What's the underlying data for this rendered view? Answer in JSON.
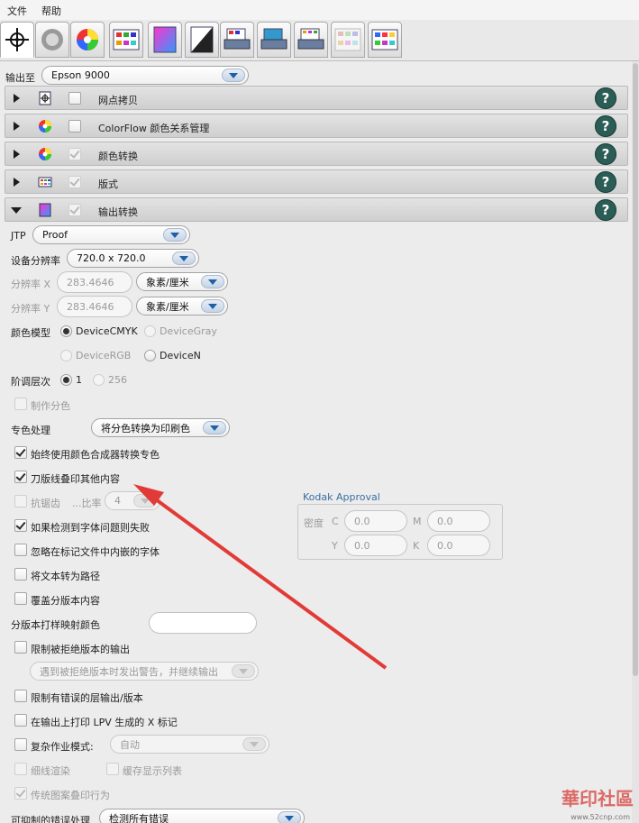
{
  "menu": {
    "file": "文件",
    "help": "帮助"
  },
  "output": {
    "label": "输出至",
    "device": "Epson 9000"
  },
  "sections": [
    {
      "title": "网点拷贝",
      "checked": false
    },
    {
      "title": "ColorFlow 颜色关系管理",
      "checked": false
    },
    {
      "title": "颜色转换",
      "checked": true
    },
    {
      "title": "版式",
      "checked": true
    },
    {
      "title": "输出转换",
      "checked": true
    }
  ],
  "help_glyph": "?",
  "jtp": {
    "label": "JTP",
    "value": "Proof"
  },
  "device_res": {
    "label": "设备分辨率",
    "value": "720.0 x 720.0"
  },
  "res_x": {
    "label": "分辨率 X",
    "value": "283.4646",
    "unit": "象素/厘米"
  },
  "res_y": {
    "label": "分辨率 Y",
    "value": "283.4646",
    "unit": "象素/厘米"
  },
  "color_model": {
    "label": "颜色模型",
    "options": [
      "DeviceCMYK",
      "DeviceGray",
      "DeviceRGB",
      "DeviceN"
    ],
    "selected": "DeviceCMYK"
  },
  "levels": {
    "label": "阶调层次",
    "options": [
      "1",
      "256"
    ],
    "selected": "1"
  },
  "make_separations": "制作分色",
  "spot": {
    "label": "专色处理",
    "value": "将分色转换为印刷色"
  },
  "checks": {
    "always_composite": "始终使用颜色合成器转换专色",
    "knife_overprint": "刀版线叠印其他内容",
    "antialias": "抗锯齿",
    "ratio_label": "...比率",
    "ratio_value": "4",
    "fail_font": "如果检测到字体问题则失败",
    "ignore_embedded": "忽略在标记文件中内嵌的字体",
    "text_to_path": "将文本转为路径",
    "overlay_version": "覆盖分版本内容",
    "limit_rejected": "限制被拒绝版本的输出",
    "limit_error_layers": "限制有错误的层输出/版本",
    "print_lpv": "在输出上打印 LPV 生成的 X 标记",
    "complex_mode": "复杂作业模式:",
    "thin_render": "细线渲染",
    "cache_list": "缓存显示列表",
    "legacy_overprint": "传统图案叠印行为"
  },
  "version_color": {
    "label": "分版本打样映射颜色",
    "value": ""
  },
  "rejected_action": "遇到被拒绝版本时发出警告，并继续输出",
  "complex_value": "自动",
  "controllable_errors": {
    "label": "可抑制的错误处理",
    "value": "检测所有错误"
  },
  "kodak": {
    "title": "Kodak Approval",
    "density_label": "密度",
    "C": "0.0",
    "M": "0.0",
    "Y": "0.0",
    "K": "0.0"
  },
  "watermark": {
    "text": "華印社區",
    "url": "www.52cnp.com"
  },
  "colors": {
    "help": "#2b5d56",
    "arrow": "#e23b37",
    "kodak_title": "#3a6ea5"
  }
}
